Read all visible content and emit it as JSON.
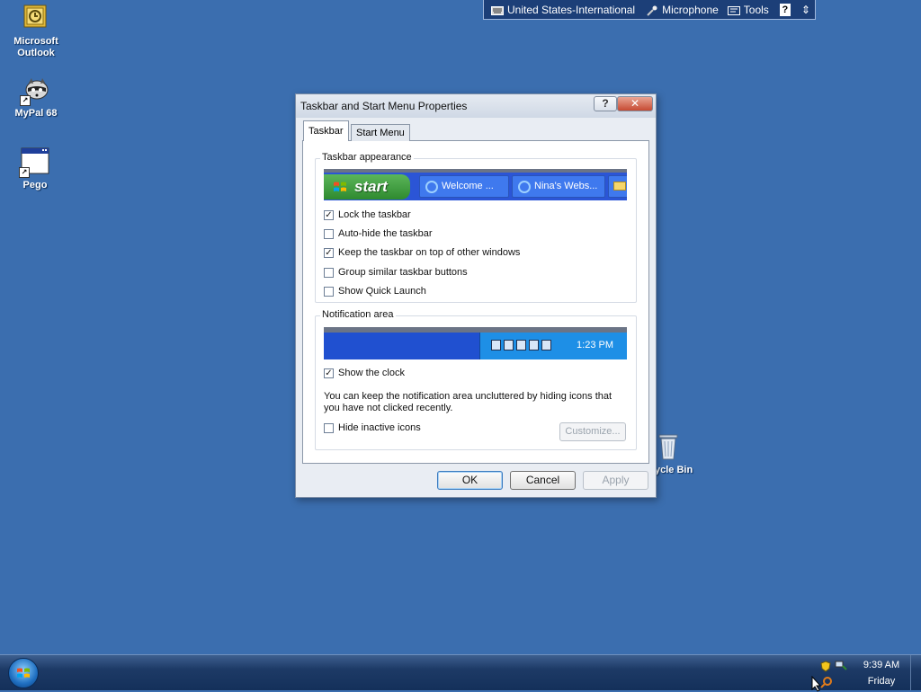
{
  "desktop": {
    "icons": [
      {
        "label_line1": "Microsoft",
        "label_line2": "Outlook",
        "icon": "outlook-icon"
      },
      {
        "label_line1": "MyPal 68",
        "label_line2": "",
        "icon": "mypal-raccoon-icon"
      },
      {
        "label_line1": "Pego",
        "label_line2": "",
        "icon": "application-window-icon"
      }
    ],
    "recycle_bin_label": "ycle Bin"
  },
  "language_bar": {
    "language": "United States-International",
    "microphone": "Microphone",
    "tools": "Tools",
    "help": "?",
    "options": "⇕"
  },
  "dialog": {
    "title": "Taskbar and Start Menu Properties",
    "help_button": "?",
    "close_button": "✕",
    "tabs": [
      {
        "label": "Taskbar",
        "active": true
      },
      {
        "label": "Start Menu",
        "active": false
      }
    ],
    "taskbar_appearance": {
      "group_title": "Taskbar appearance",
      "preview": {
        "start_label": "start",
        "buttons": [
          "Welcome ...",
          "Nina's Webs..."
        ]
      },
      "options": [
        {
          "label": "Lock the taskbar",
          "checked": true,
          "mark": "✓"
        },
        {
          "label": "Auto-hide the taskbar",
          "checked": false,
          "mark": ""
        },
        {
          "label": "Keep the taskbar on top of other windows",
          "checked": true,
          "mark": "✓"
        },
        {
          "label": "Group similar taskbar buttons",
          "checked": false,
          "mark": ""
        },
        {
          "label": "Show Quick Launch",
          "checked": false,
          "mark": ""
        }
      ]
    },
    "notification_area": {
      "group_title": "Notification area",
      "preview_clock": "1:23 PM",
      "show_clock": {
        "label": "Show the clock",
        "checked": true,
        "mark": "✓"
      },
      "description": "You can keep the notification area uncluttered by hiding icons that you have not clicked recently.",
      "hide_inactive": {
        "label": "Hide inactive icons",
        "checked": false,
        "mark": ""
      },
      "customize_button": "Customize..."
    },
    "buttons": {
      "ok": "OK",
      "cancel": "Cancel",
      "apply": "Apply"
    }
  },
  "taskbar": {
    "clock_time": "9:39 AM",
    "clock_day": "Friday"
  },
  "colors": {
    "desktop": "#3b6eaf",
    "taskbar": "#1d3a66",
    "dialog_face": "#e9edf3",
    "close_button": "#c64a32"
  }
}
